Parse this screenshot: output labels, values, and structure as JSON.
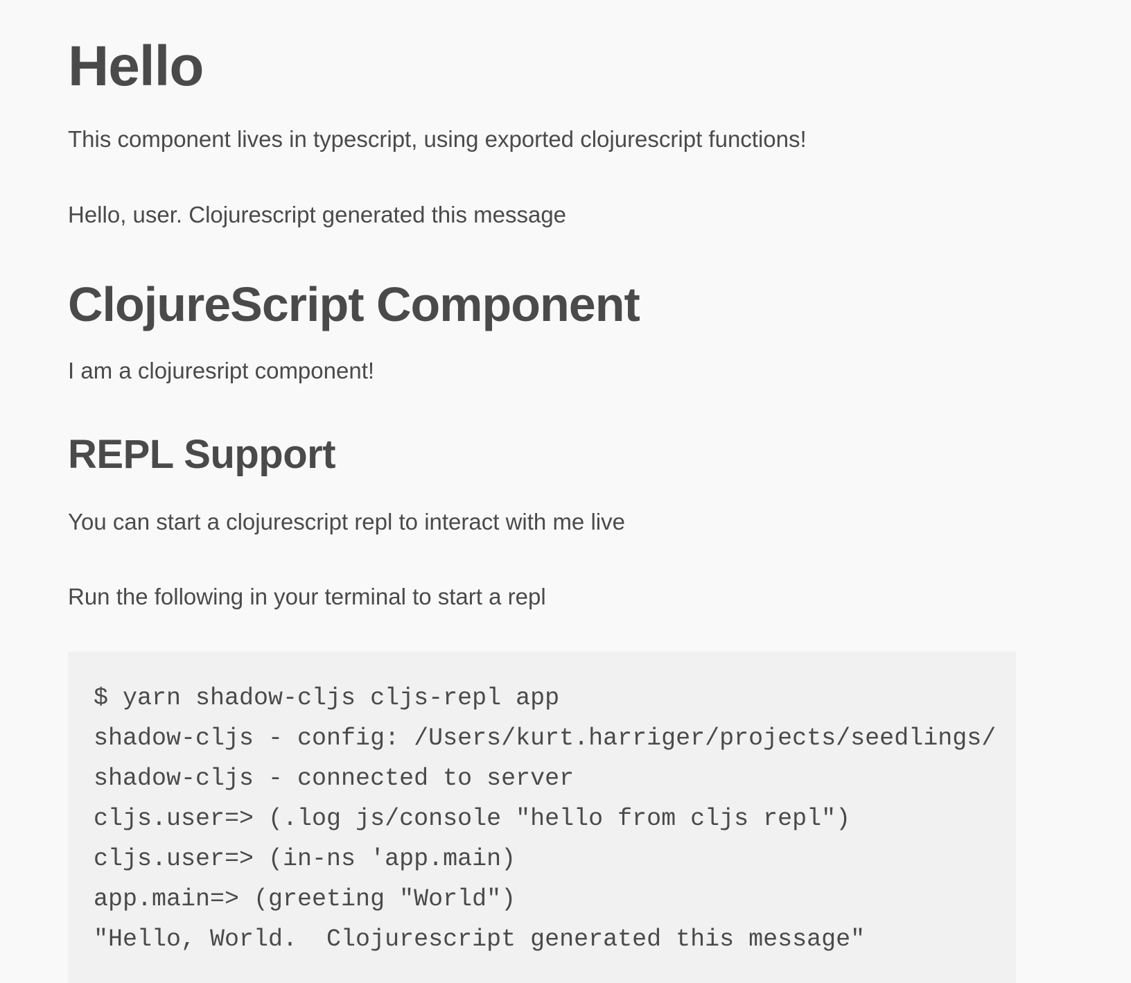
{
  "headings": {
    "hello": "Hello",
    "clojurescript_component": "ClojureScript Component",
    "repl_support": "REPL Support"
  },
  "paragraphs": {
    "intro": "This component lives in typescript, using exported clojurescript functions!",
    "greeting_message": "Hello, user. Clojurescript generated this message",
    "component_description": "I am a clojuresript component!",
    "repl_description": "You can start a clojurescript repl to interact with me live",
    "terminal_instruction": "Run the following in your terminal to start a repl"
  },
  "code": {
    "lines": [
      "$ yarn shadow-cljs cljs-repl app",
      "shadow-cljs - config: /Users/kurt.harriger/projects/seedlings/",
      "shadow-cljs - connected to server",
      "cljs.user=> (.log js/console \"hello from cljs repl\")",
      "cljs.user=> (in-ns 'app.main)",
      "app.main=> (greeting \"World\")",
      "\"Hello, World.  Clojurescript generated this message\""
    ]
  }
}
